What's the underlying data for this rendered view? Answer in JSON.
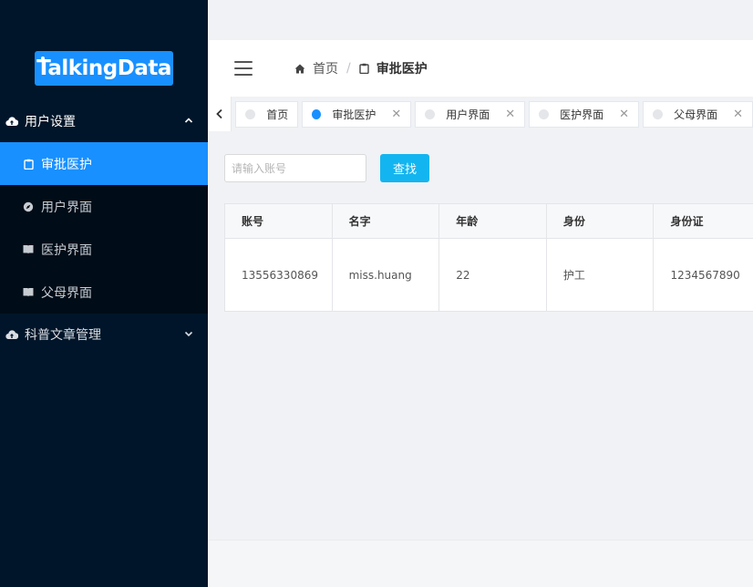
{
  "logo": {
    "text": "TalkingData"
  },
  "sidebar": {
    "groups": [
      {
        "label": "用户设置",
        "expanded": true,
        "icon": "cloud-upload-icon"
      },
      {
        "label": "科普文章管理",
        "expanded": false,
        "icon": "cloud-upload-icon"
      }
    ],
    "items": [
      {
        "label": "审批医护",
        "active": true,
        "icon": "clipboard-icon"
      },
      {
        "label": "用户界面",
        "active": false,
        "icon": "compass-icon"
      },
      {
        "label": "医护界面",
        "active": false,
        "icon": "book-icon"
      },
      {
        "label": "父母界面",
        "active": false,
        "icon": "book-icon"
      }
    ]
  },
  "header": {
    "breadcrumb": {
      "home": "首页",
      "separator": "/",
      "current": "审批医护"
    }
  },
  "tabs": [
    {
      "label": "首页",
      "active": false,
      "closable": false
    },
    {
      "label": "审批医护",
      "active": true,
      "closable": true
    },
    {
      "label": "用户界面",
      "active": false,
      "closable": true
    },
    {
      "label": "医护界面",
      "active": false,
      "closable": true
    },
    {
      "label": "父母界面",
      "active": false,
      "closable": true
    }
  ],
  "search": {
    "placeholder": "请输入账号",
    "value": "",
    "button_label": "查找"
  },
  "table": {
    "columns": [
      "账号",
      "名字",
      "年龄",
      "身份",
      "身份证"
    ],
    "rows": [
      [
        "13556330869",
        "miss.huang",
        "22",
        "护工",
        "1234567890"
      ]
    ]
  },
  "colors": {
    "sidebar_bg": "#001529",
    "accent": "#1890ff",
    "button": "#13b5f0"
  }
}
